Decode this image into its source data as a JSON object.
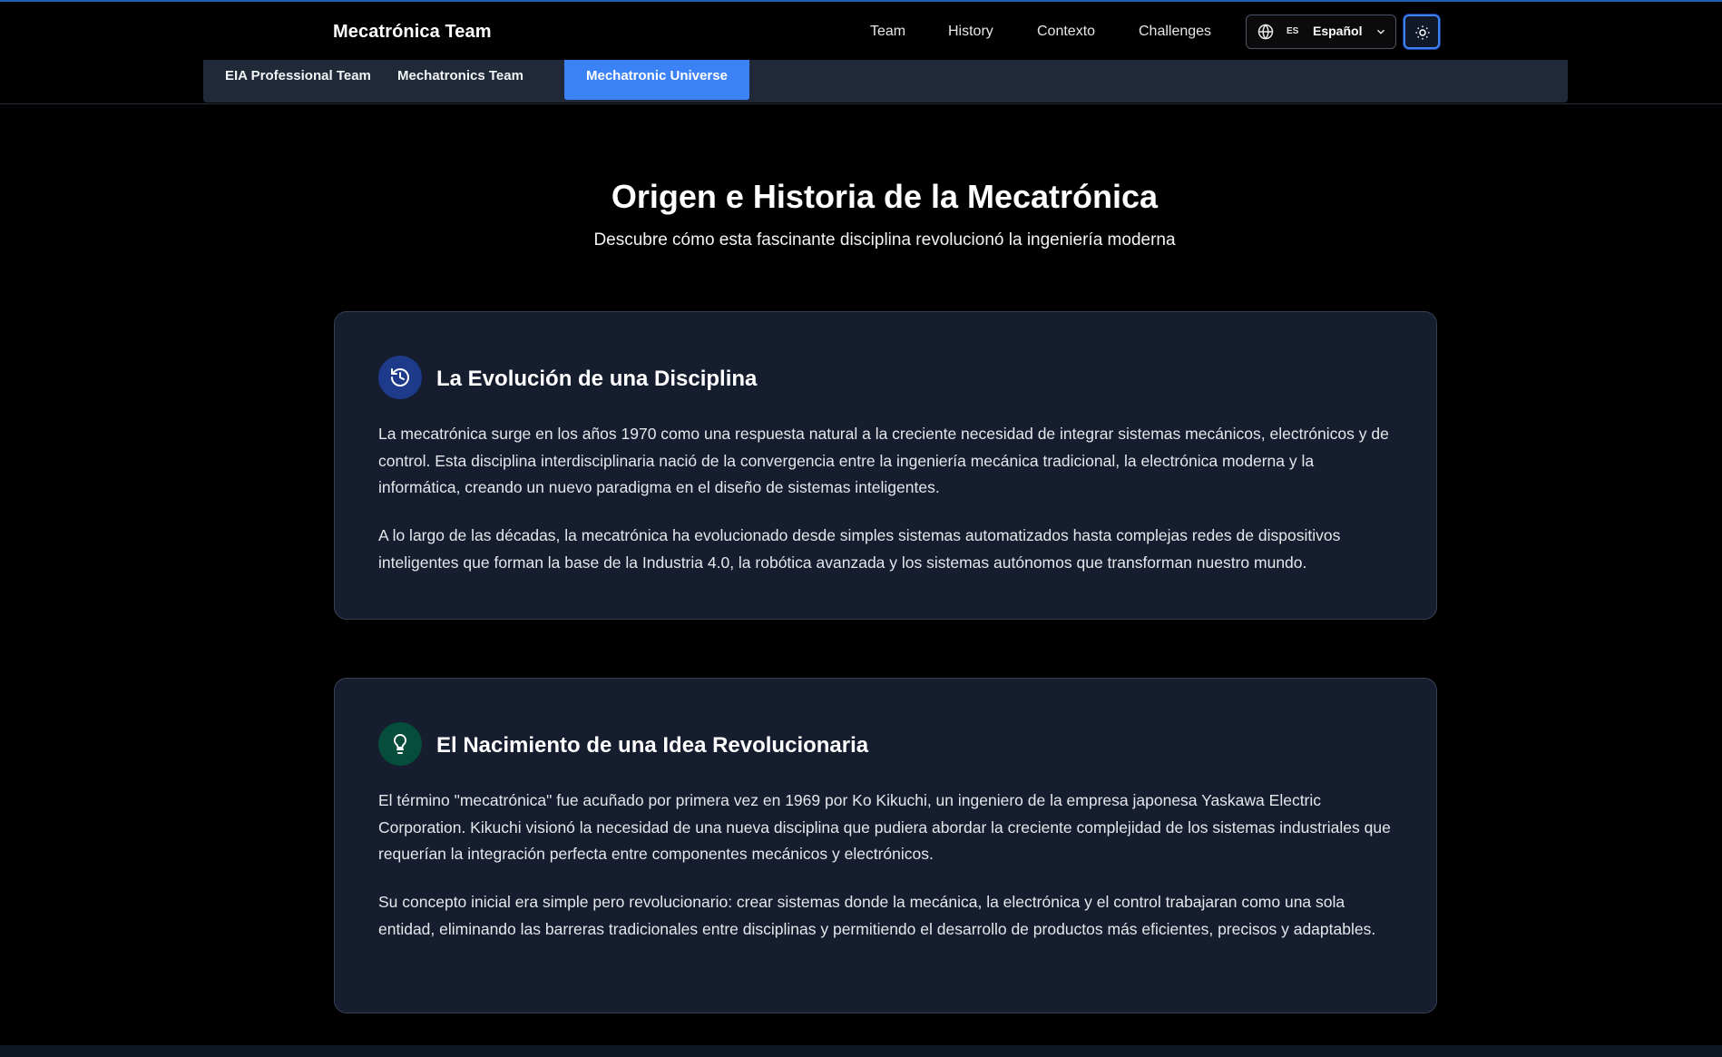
{
  "brand": "Mecatrónica Team",
  "nav": {
    "links": [
      "Team",
      "History",
      "Contexto",
      "Challenges"
    ],
    "language": {
      "code": "ES",
      "name": "Español"
    },
    "theme_icon": "sun-icon"
  },
  "subnav": {
    "tabs": [
      "EIA Professional Team",
      "Mechatronics Team",
      "Mechatronic Universe"
    ],
    "active_index": 2
  },
  "hero": {
    "title": "Origen e Historia de la Mecatrónica",
    "subtitle": "Descubre cómo esta fascinante disciplina revolucionó la ingeniería moderna"
  },
  "cards": [
    {
      "icon": "history-icon",
      "icon_bg": "#1e3a8a",
      "title": "La Evolución de una Disciplina",
      "paragraphs": [
        "La mecatrónica surge en los años 1970 como una respuesta natural a la creciente necesidad de integrar sistemas mecánicos, electrónicos y de control. Esta disciplina interdisciplinaria nació de la convergencia entre la ingeniería mecánica tradicional, la electrónica moderna y la informática, creando un nuevo paradigma en el diseño de sistemas inteligentes.",
        "A lo largo de las décadas, la mecatrónica ha evolucionado desde simples sistemas automatizados hasta complejas redes de dispositivos inteligentes que forman la base de la Industria 4.0, la robótica avanzada y los sistemas autónomos que transforman nuestro mundo."
      ]
    },
    {
      "icon": "lightbulb-icon",
      "icon_bg": "#064e3b",
      "title": "El Nacimiento de una Idea Revolucionaria",
      "paragraphs": [
        "El término \"mecatrónica\" fue acuñado por primera vez en 1969 por Ko Kikuchi, un ingeniero de la empresa japonesa Yaskawa Electric Corporation. Kikuchi visionó la necesidad de una nueva disciplina que pudiera abordar la creciente complejidad de los sistemas industriales que requerían la integración perfecta entre componentes mecánicos y electrónicos.",
        "Su concepto inicial era simple pero revolucionario: crear sistemas donde la mecánica, la electrónica y el control trabajaran como una sola entidad, eliminando las barreras tradicionales entre disciplinas y permitiendo el desarrollo de productos más eficientes, precisos y adaptables."
      ]
    }
  ],
  "colors": {
    "accent": "#3b82f6",
    "card_bg": "#151d2e",
    "subnav_bg": "#1f2937",
    "page_bg": "#000000"
  }
}
